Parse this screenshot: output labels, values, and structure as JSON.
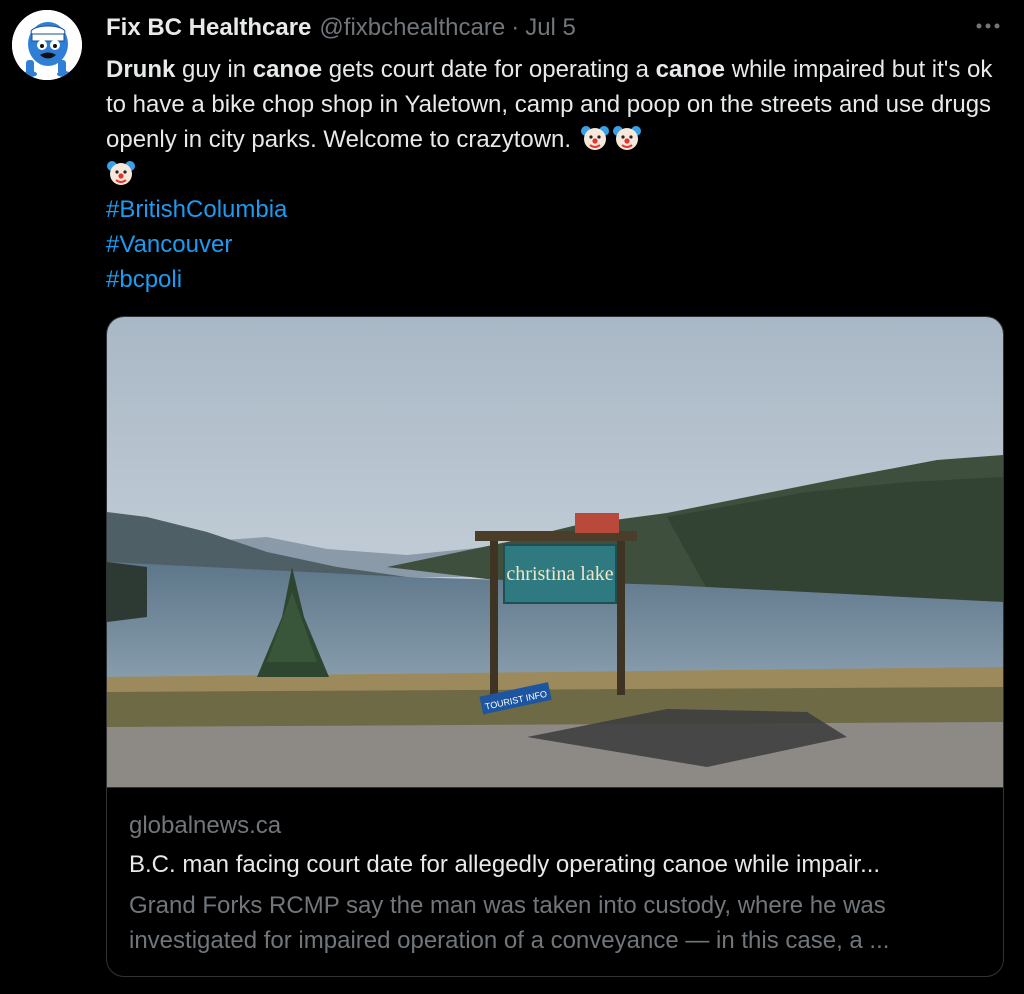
{
  "author": {
    "name": "Fix BC Healthcare",
    "handle": "@fixbchealthcare",
    "separator": "·",
    "date": "Jul 5"
  },
  "tweet": {
    "seg1": "Drunk",
    "seg2": " guy in ",
    "seg3": "canoe",
    "seg4": " gets court date for operating a ",
    "seg5": "canoe",
    "seg6": " while  impaired but it's ok to have a bike chop shop in Yaletown, camp and poop on the streets and use drugs openly in city parks.  Welcome to crazytown. ",
    "hashtags": [
      "#BritishColumbia",
      "#Vancouver",
      "#bcpoli"
    ]
  },
  "card": {
    "domain": "globalnews.ca",
    "title": "B.C. man facing court date for allegedly operating canoe while impair...",
    "description": "Grand Forks RCMP say the man was taken into custody, where he was investigated for impaired operation of a conveyance — in this case, a ...",
    "sign_text": "christina lake",
    "sign_small": "TOURIST INFO"
  },
  "icons": {
    "avatar": "mascot-avatar",
    "more": "more-options-icon",
    "emoji": "clown-face-emoji"
  },
  "colors": {
    "background": "#000000",
    "text": "#e7e9ea",
    "secondary": "#71767b",
    "link": "#1d9bf0",
    "border": "#2f3336"
  }
}
